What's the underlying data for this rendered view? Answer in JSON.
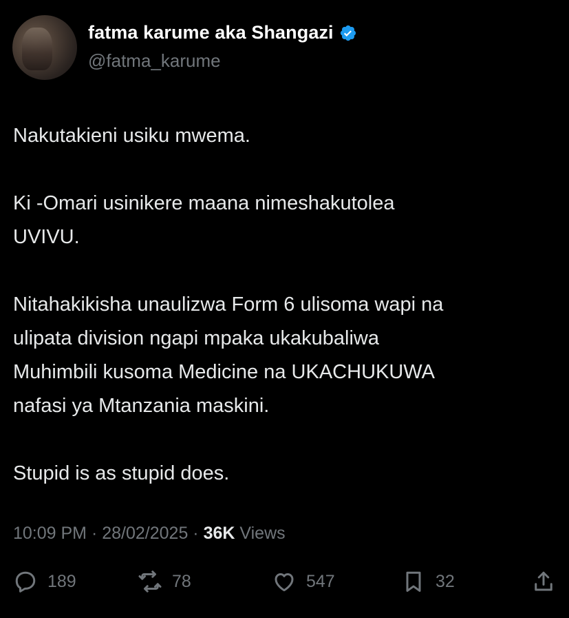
{
  "author": {
    "display_name": "fatma karume aka Shangazi",
    "handle": "@fatma_karume",
    "verified": true,
    "verified_color": "#1d9bf0"
  },
  "tweet": {
    "paragraphs": [
      [
        "Nakutakieni usiku mwema."
      ],
      [
        "Ki -Omari usinikere maana nimeshakutolea",
        "UVIVU."
      ],
      [
        "Nitahakikisha unaulizwa Form 6 ulisoma wapi na",
        "ulipata division ngapi mpaka ukakubaliwa",
        "Muhimbili kusoma Medicine na UKACHUKUWA",
        "nafasi ya Mtanzania maskini."
      ],
      [
        "Stupid is as stupid does."
      ]
    ]
  },
  "meta": {
    "time": "10:09 PM",
    "separator": " · ",
    "date": "28/02/2025",
    "views_count": "36K",
    "views_label": " Views"
  },
  "actions": {
    "replies": "189",
    "reposts": "78",
    "likes": "547",
    "bookmarks": "32"
  },
  "colors": {
    "background": "#000000",
    "text": "#e7e9ea",
    "muted": "#71767b"
  }
}
